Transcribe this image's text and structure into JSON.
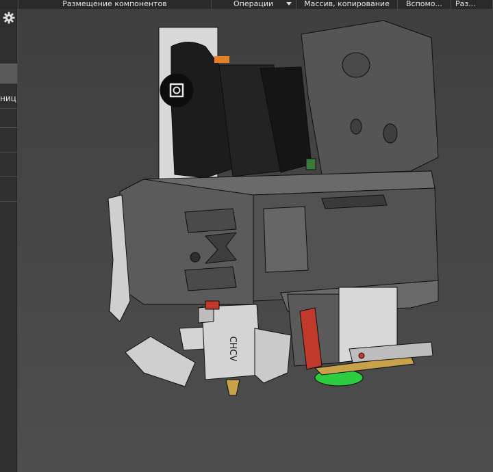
{
  "menu": {
    "items": [
      {
        "label": ""
      },
      {
        "label": "Размещение компонентов"
      },
      {
        "label": "Операции"
      },
      {
        "label": "Массив, копирование"
      },
      {
        "label": "Вспомо..."
      },
      {
        "label": "Раз..."
      }
    ]
  },
  "left_panel": {
    "partial_label": "ниц"
  },
  "toolbar": {
    "buttons": [
      {
        "icon": "sketch-plane-icon"
      },
      {
        "icon": "component-placement-icon"
      },
      {
        "icon": "zoom-window-icon"
      },
      {
        "icon": "dropdown-arrow-icon"
      },
      {
        "icon": "normal-to-icon"
      },
      {
        "icon": "orientation-axes-icon"
      },
      {
        "icon": "dropdown-arrow-icon"
      },
      {
        "icon": "shaded-cube-icon"
      },
      {
        "icon": "wireframe-cube-icon"
      }
    ]
  },
  "model": {
    "mounted_text": "CHCV",
    "colors": {
      "background": "#474747",
      "black_parts": "#1c1c1c",
      "grey_parts": "#5a5a5a",
      "light_parts": "#d8d8d8",
      "red_part": "#c0392b",
      "green_part": "#2ecc40",
      "orange_wire": "#e67e22",
      "brass": "#c8a24a"
    }
  }
}
